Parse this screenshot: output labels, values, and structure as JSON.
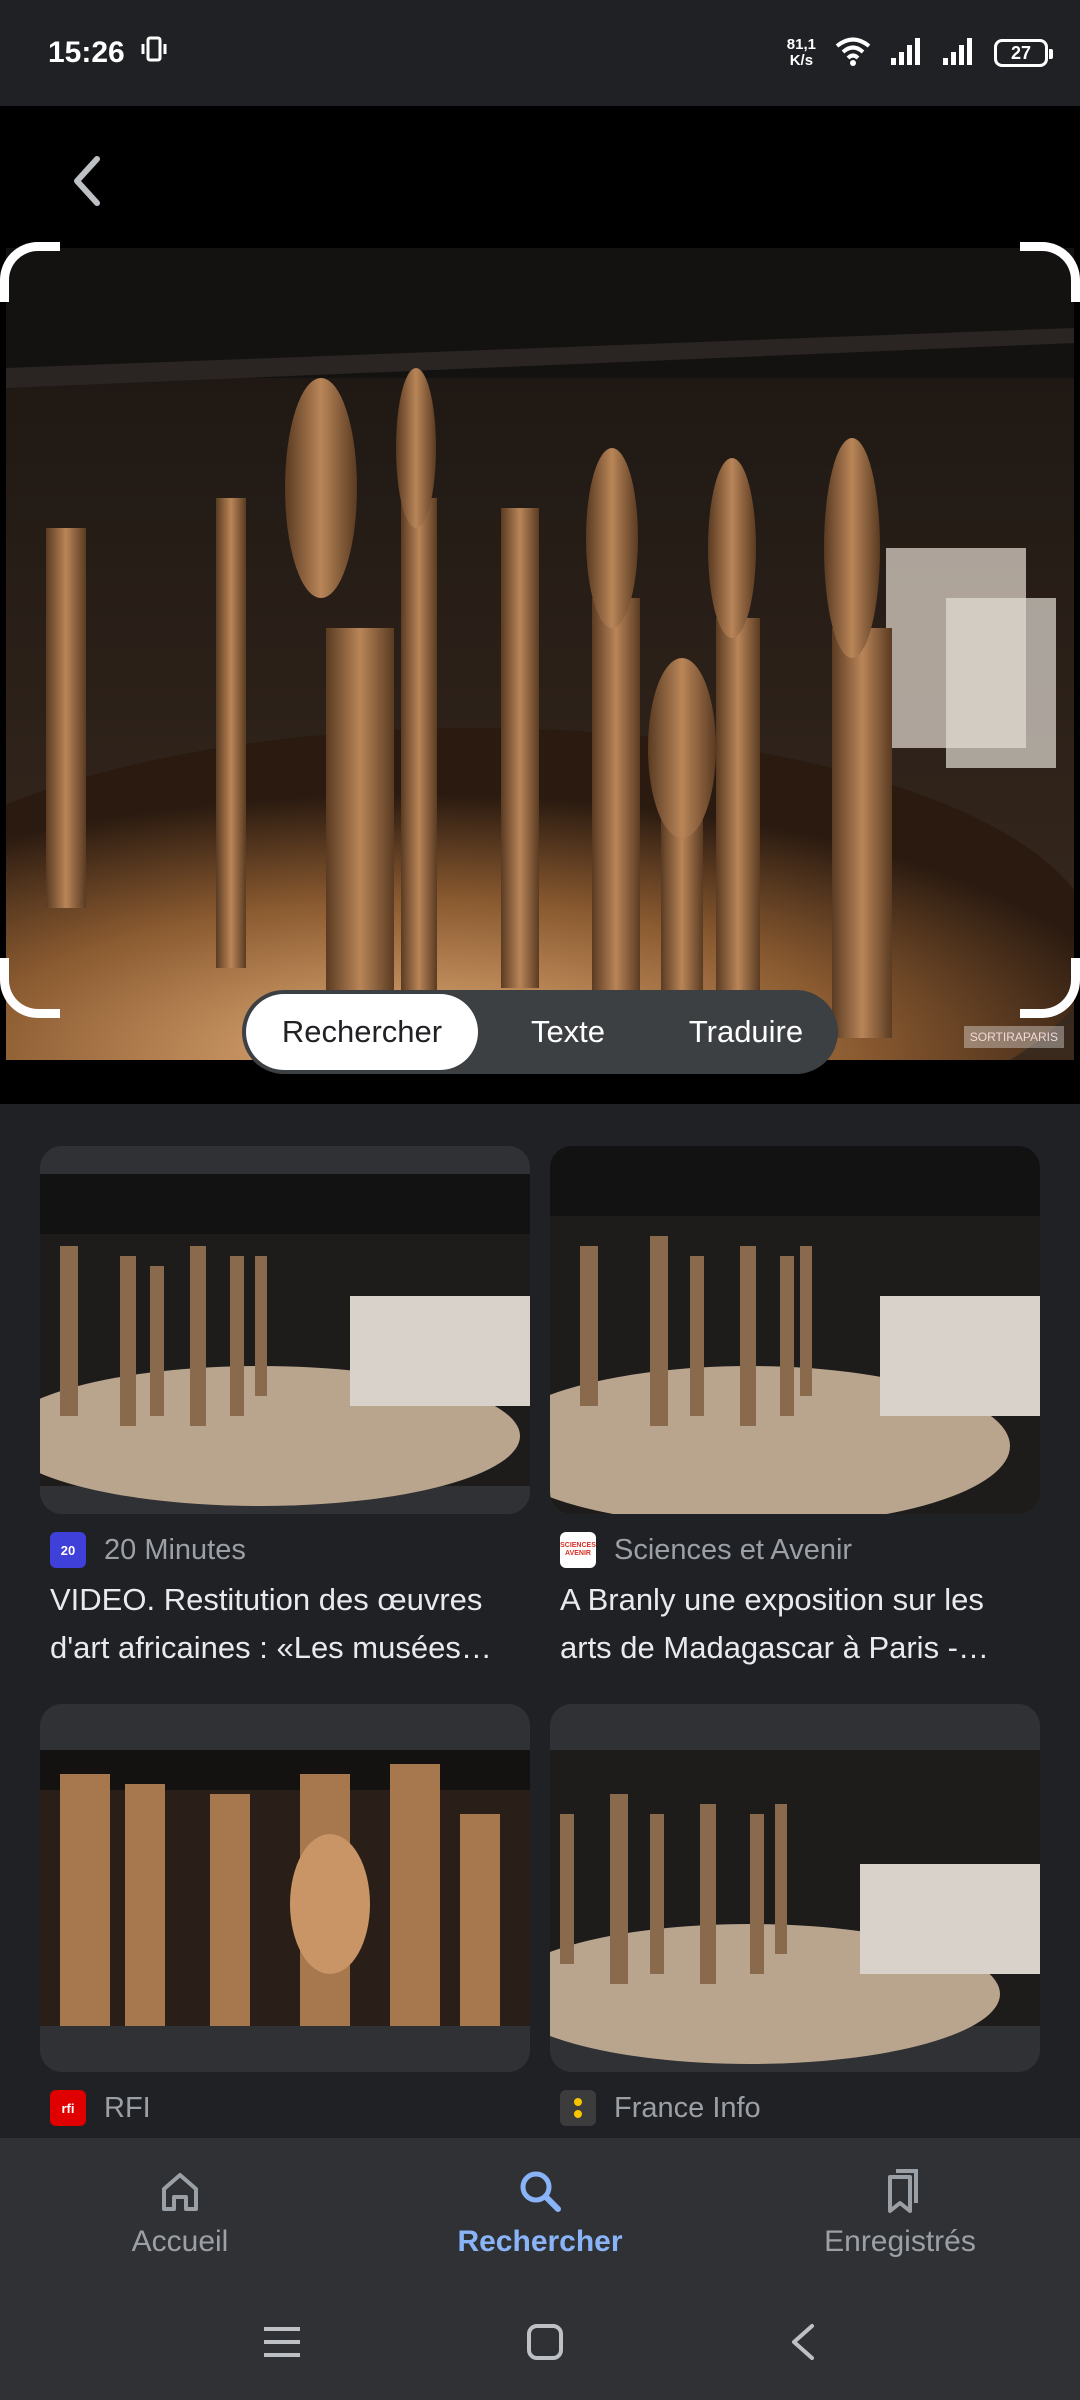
{
  "status_bar": {
    "time": "15:26",
    "net_speed_value": "81,1",
    "net_speed_unit": "K/s",
    "battery": "27"
  },
  "lens": {
    "watermark": "SORTIRAPARIS",
    "modes": [
      {
        "label": "Rechercher",
        "active": true
      },
      {
        "label": "Texte",
        "active": false
      },
      {
        "label": "Traduire",
        "active": false
      }
    ]
  },
  "results": [
    {
      "source": "20 Minutes",
      "favicon_text": "20",
      "favicon_color": "#3f3fd9",
      "title": "VIDEO. Restitution des œuvres d'art africaines : «Les musées…"
    },
    {
      "source": "Sciences et Avenir",
      "favicon_text": "SCIENCES AVENIR",
      "favicon_color": "#d93025",
      "title": "A Branly une exposition sur les arts de Madagascar à Paris -…"
    },
    {
      "source": "RFI",
      "favicon_text": "rfi",
      "favicon_color": "#e00000",
      "title": ""
    },
    {
      "source": "France Info",
      "favicon_text": "",
      "favicon_color": "#3c3c3c",
      "title": ""
    }
  ],
  "bottom_nav": [
    {
      "label": "Accueil",
      "icon": "home-icon",
      "active": false
    },
    {
      "label": "Rechercher",
      "icon": "search-icon",
      "active": true
    },
    {
      "label": "Enregistrés",
      "icon": "bookmarks-icon",
      "active": false
    }
  ],
  "colors": {
    "accent": "#8ab4f8",
    "background": "#202124",
    "surface": "#303134"
  }
}
